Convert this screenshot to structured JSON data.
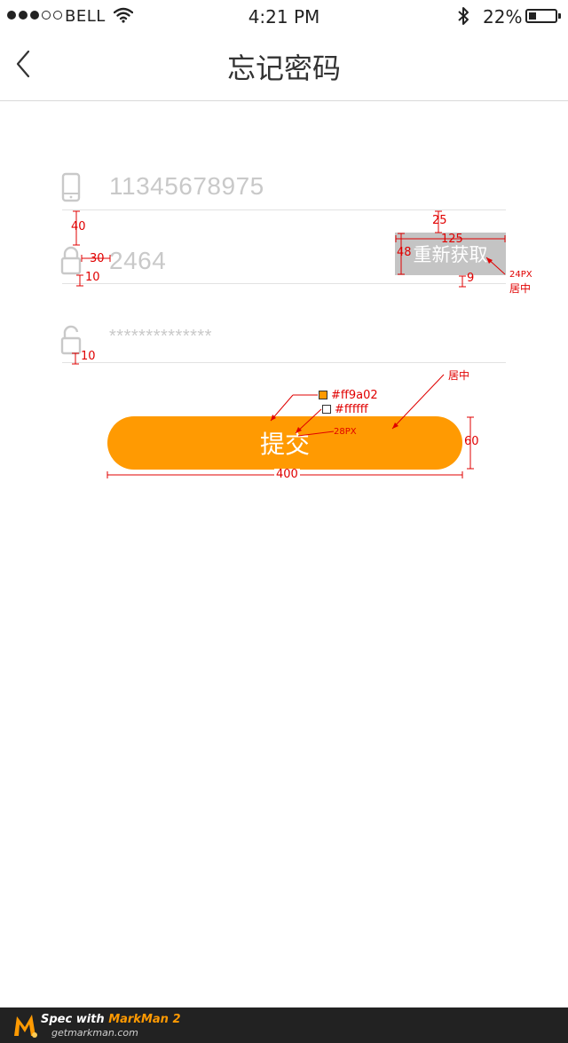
{
  "status_bar": {
    "carrier": "BELL",
    "time": "4:21 PM",
    "battery_percent": "22%",
    "battery_level": 0.22,
    "signal_dots_filled": 3,
    "icons": [
      "signal-dots-icon",
      "wifi-icon",
      "bluetooth-icon",
      "battery-icon"
    ]
  },
  "nav": {
    "back_icon": "chevron-left-icon",
    "title": "忘记密码"
  },
  "form": {
    "phone": {
      "icon": "phone-icon",
      "value": "11345678975"
    },
    "code": {
      "icon": "lock-icon",
      "value": "2464",
      "resend_label": "重新获取"
    },
    "password": {
      "icon": "unlock-icon",
      "value": "**************"
    },
    "submit_label": "提交"
  },
  "annotations": {
    "color": "#e00000",
    "phone_gap": "40",
    "icon_gap": "30",
    "icon_bottom_1": "10",
    "icon_bottom_2": "10",
    "resend_top": "25",
    "resend_width": "125",
    "resend_height": "48",
    "resend_bottom": "9",
    "resend_font": "24PX",
    "resend_align": "居中",
    "submit_align": "居中",
    "submit_color": "#ff9a02",
    "submit_text_color": "#ffffff",
    "submit_font": "28PX",
    "submit_height": "60",
    "submit_width": "400"
  },
  "colors": {
    "accent": "#ff9a02",
    "resend_bg": "#c4c4c4",
    "placeholder": "#c9c9c9",
    "divider": "#e2e2e2"
  },
  "footer": {
    "prefix": "Spec with ",
    "brand": "MarkMan 2",
    "url": "getmarkman.com"
  }
}
